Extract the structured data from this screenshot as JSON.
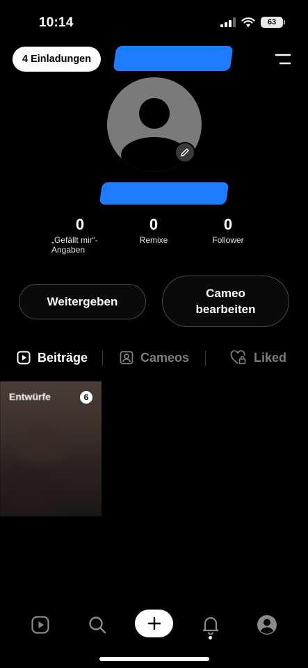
{
  "status_bar": {
    "time": "10:14",
    "battery": "63"
  },
  "header": {
    "invites_label": "4 Einladungen"
  },
  "stats": [
    {
      "value": "0",
      "label": "„Gefällt mir“-Angaben"
    },
    {
      "value": "0",
      "label": "Remixe"
    },
    {
      "value": "0",
      "label": "Follower"
    }
  ],
  "actions": {
    "share_label": "Weitergeben",
    "edit_cameo_label": "Cameo bearbeiten"
  },
  "tabs": [
    {
      "label": "Beiträge",
      "icon": "play-square-icon",
      "active": true
    },
    {
      "label": "Cameos",
      "icon": "portrait-icon",
      "active": false
    },
    {
      "label": "Liked",
      "icon": "heart-lock-icon",
      "active": false
    }
  ],
  "drafts": {
    "label": "Entwürfe",
    "count": "6"
  },
  "bottom_nav": [
    {
      "icon": "feed-icon"
    },
    {
      "icon": "search-icon"
    },
    {
      "icon": "plus-icon"
    },
    {
      "icon": "bell-icon"
    },
    {
      "icon": "profile-icon"
    }
  ],
  "colors": {
    "background": "#000000",
    "redaction": "#1f7bff",
    "inactive_text": "#7d7d7d"
  }
}
